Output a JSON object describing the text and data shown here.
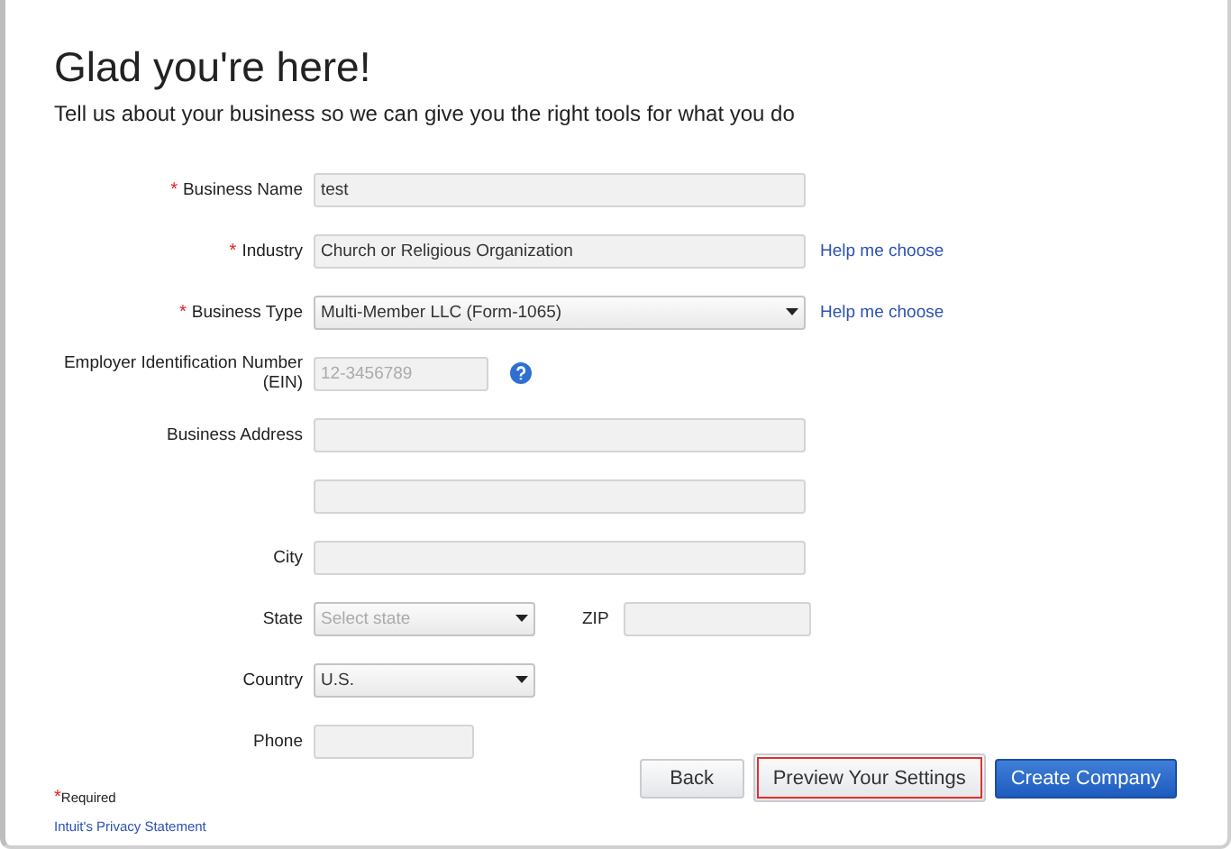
{
  "heading": "Glad you're here!",
  "subheading": "Tell us about your business so we can give you the right tools for what you do",
  "required_mark": "*",
  "rows": [
    {
      "label": "Business Name",
      "required": true,
      "control": {
        "kind": "text",
        "value": "test"
      }
    },
    {
      "label": "Industry",
      "required": true,
      "control": {
        "kind": "text",
        "value": "Church or Religious Organization"
      },
      "help": "Help me choose"
    },
    {
      "label": "Business Type",
      "required": true,
      "control": {
        "kind": "select",
        "value": "Multi-Member LLC (Form-1065)"
      },
      "help": "Help me choose"
    },
    {
      "label": "Employer Identification Number (EIN)",
      "required": false,
      "control": {
        "kind": "text",
        "placeholder": "12-3456789"
      },
      "info": true
    },
    {
      "label": "Business Address",
      "required": false,
      "control": {
        "kind": "text"
      }
    },
    {
      "required": false,
      "control": {
        "kind": "text"
      }
    },
    {
      "label": "City",
      "required": false,
      "control": {
        "kind": "text"
      }
    },
    {
      "label": "State",
      "required": false,
      "control": {
        "kind": "select",
        "placeholder": "Select state"
      },
      "extra": {
        "label": "ZIP",
        "control": {
          "kind": "text"
        }
      }
    },
    {
      "label": "Country",
      "required": false,
      "control": {
        "kind": "select",
        "value": "U.S."
      }
    },
    {
      "label": "Phone",
      "required": false,
      "control": {
        "kind": "text"
      }
    }
  ],
  "required_note": "Required",
  "privacy_link": "Intuit's Privacy Statement",
  "buttons": [
    {
      "label": "Back",
      "kind": "secondary",
      "focused": false
    },
    {
      "label": "Preview Your Settings",
      "kind": "secondary",
      "focused": true
    },
    {
      "label": "Create Company",
      "kind": "primary",
      "focused": false
    }
  ]
}
